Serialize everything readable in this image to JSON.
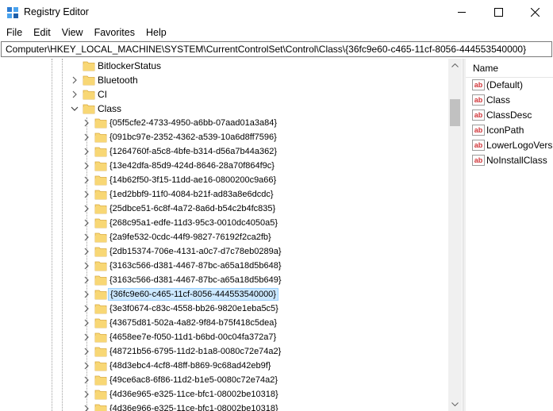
{
  "window": {
    "title": "Registry Editor",
    "controls": [
      "minimize",
      "maximize",
      "close"
    ]
  },
  "menu": [
    "File",
    "Edit",
    "View",
    "Favorites",
    "Help"
  ],
  "address": "Computer\\HKEY_LOCAL_MACHINE\\SYSTEM\\CurrentControlSet\\Control\\Class\\{36fc9e60-c465-11cf-8056-444553540000}",
  "tree": {
    "top_items": [
      {
        "label": "BitlockerStatus",
        "expander": "none"
      },
      {
        "label": "Bluetooth",
        "expander": "collapsed"
      },
      {
        "label": "CI",
        "expander": "collapsed"
      },
      {
        "label": "Class",
        "expander": "expanded"
      }
    ],
    "class_children": [
      "{05f5cfe2-4733-4950-a6bb-07aad01a3a84}",
      "{091bc97e-2352-4362-a539-10a6d8ff7596}",
      "{1264760f-a5c8-4bfe-b314-d56a7b44a362}",
      "{13e42dfa-85d9-424d-8646-28a70f864f9c}",
      "{14b62f50-3f15-11dd-ae16-0800200c9a66}",
      "{1ed2bbf9-11f0-4084-b21f-ad83a8e6dcdc}",
      "{25dbce51-6c8f-4a72-8a6d-b54c2b4fc835}",
      "{268c95a1-edfe-11d3-95c3-0010dc4050a5}",
      "{2a9fe532-0cdc-44f9-9827-76192f2ca2fb}",
      "{2db15374-706e-4131-a0c7-d7c78eb0289a}",
      "{3163c566-d381-4467-87bc-a65a18d5b648}",
      "{3163c566-d381-4467-87bc-a65a18d5b649}",
      "{36fc9e60-c465-11cf-8056-444553540000}",
      "{3e3f0674-c83c-4558-bb26-9820e1eba5c5}",
      "{43675d81-502a-4a82-9f84-b75f418c5dea}",
      "{4658ee7e-f050-11d1-b6bd-00c04fa372a7}",
      "{48721b56-6795-11d2-b1a8-0080c72e74a2}",
      "{48d3ebc4-4cf8-48ff-b869-9c68ad42eb9f}",
      "{49ce6ac8-6f86-11d2-b1e5-0080c72e74a2}",
      "{4d36e965-e325-11ce-bfc1-08002be10318}",
      "{4d36e966-e325-11ce-bfc1-08002be10318}"
    ],
    "selected": "{36fc9e60-c465-11cf-8056-444553540000}"
  },
  "values": {
    "column_header": "Name",
    "items": [
      "(Default)",
      "Class",
      "ClassDesc",
      "IconPath",
      "LowerLogoVersi",
      "NoInstallClass"
    ]
  },
  "colors": {
    "folder": "#f8d775",
    "selection": "#cce8ff",
    "scrollbar_thumb": "#c1c1c1",
    "value_icon": "#d13438"
  }
}
